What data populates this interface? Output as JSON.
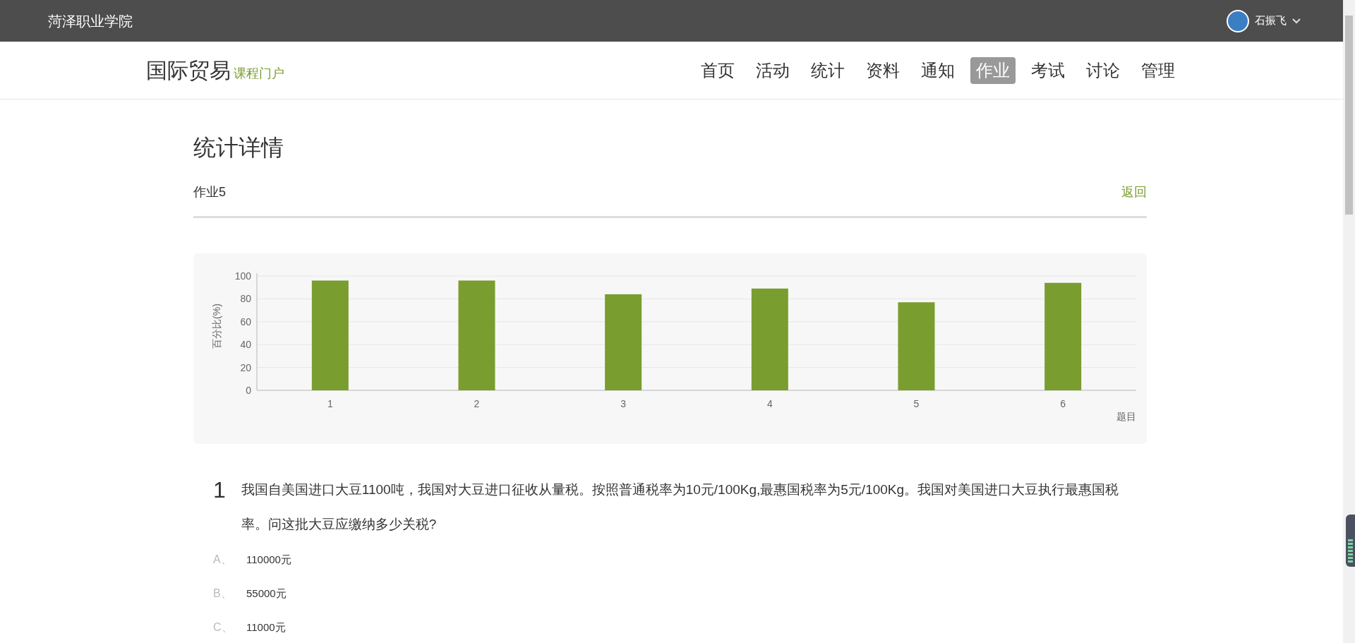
{
  "top_bar": {
    "school": "菏泽职业学院",
    "user": {
      "name": "石振飞"
    }
  },
  "header": {
    "course": "国际贸易",
    "portal": "课程门户",
    "nav": [
      {
        "label": "首页",
        "selected": false
      },
      {
        "label": "活动",
        "selected": false
      },
      {
        "label": "统计",
        "selected": false
      },
      {
        "label": "资料",
        "selected": false
      },
      {
        "label": "通知",
        "selected": false
      },
      {
        "label": "作业",
        "selected": true
      },
      {
        "label": "考试",
        "selected": false
      },
      {
        "label": "讨论",
        "selected": false
      },
      {
        "label": "管理",
        "selected": false
      }
    ]
  },
  "page": {
    "title": "统计详情",
    "assignment": "作业5",
    "back_link": "返回"
  },
  "chart_data": {
    "type": "bar",
    "xlabel": "题目",
    "ylabel": "百分比(%)",
    "categories": [
      "1",
      "2",
      "3",
      "4",
      "5",
      "6"
    ],
    "series": [
      {
        "color": "#7a9d2f",
        "values": [
          96,
          96,
          84,
          89,
          77,
          94
        ]
      }
    ],
    "grid": true,
    "ylim": [
      0,
      100
    ],
    "yticks": [
      0,
      20,
      40,
      60,
      80,
      100
    ]
  },
  "questions": [
    {
      "number": "1",
      "text": "我国自美国进口大豆1100吨，我国对大豆进口征收从量税。按照普通税率为10元/100Kg,最惠国税率为5元/100Kg。我国对美国进口大豆执行最惠国税率。问这批大豆应缴纳多少关税?",
      "options": [
        {
          "letter": "A、",
          "text": "110000元"
        },
        {
          "letter": "B、",
          "text": "55000元"
        },
        {
          "letter": "C、",
          "text": "11000元"
        }
      ]
    }
  ]
}
